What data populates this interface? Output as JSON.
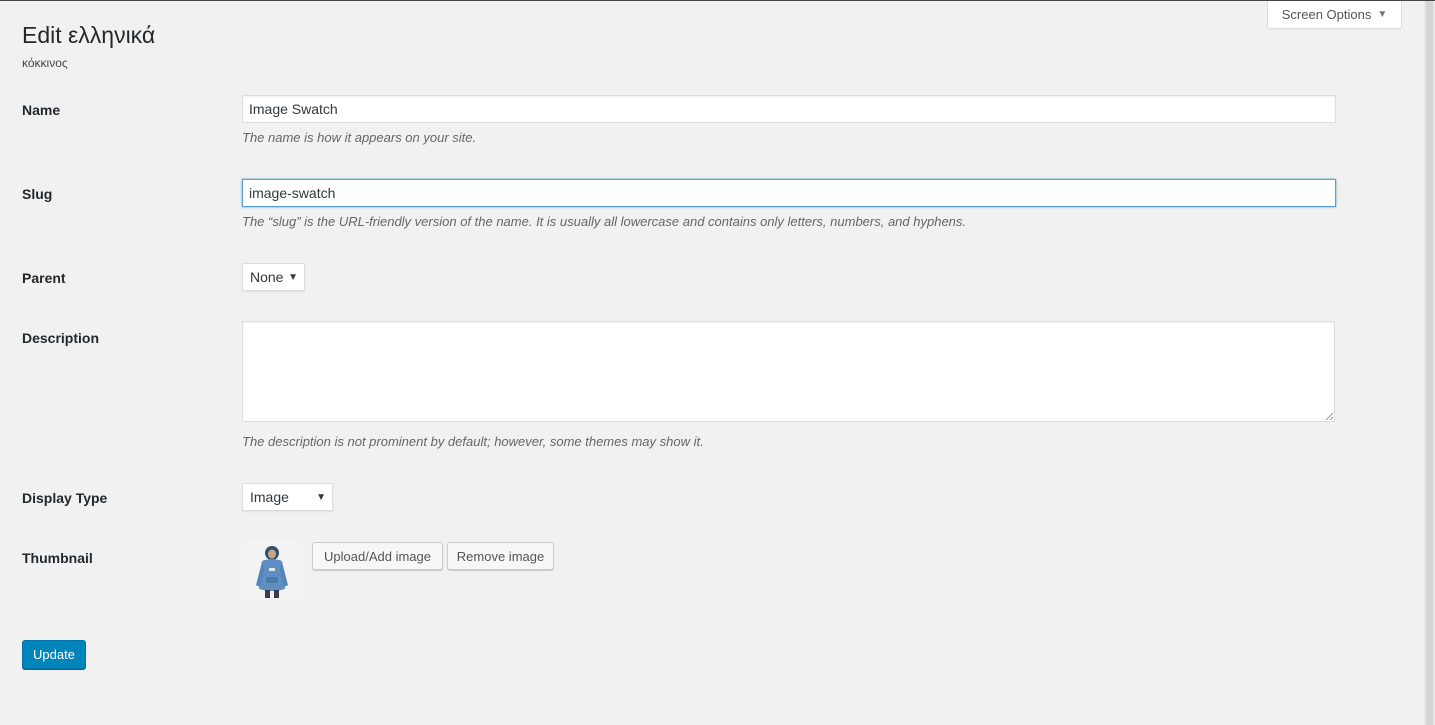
{
  "header": {
    "title": "Edit ελληνικά",
    "subtitle": "κόκκινος",
    "screen_options": "Screen Options"
  },
  "form": {
    "name": {
      "label": "Name",
      "value": "Image Swatch",
      "description": "The name is how it appears on your site."
    },
    "slug": {
      "label": "Slug",
      "value": "image-swatch",
      "description": "The “slug” is the URL-friendly version of the name. It is usually all lowercase and contains only letters, numbers, and hyphens."
    },
    "parent": {
      "label": "Parent",
      "selected": "None"
    },
    "description": {
      "label": "Description",
      "value": "",
      "description": "The description is not prominent by default; however, some themes may show it."
    },
    "display_type": {
      "label": "Display Type",
      "selected": "Image"
    },
    "thumbnail": {
      "label": "Thumbnail",
      "image_icon": "hoodie-image",
      "upload_label": "Upload/Add image",
      "remove_label": "Remove image"
    },
    "submit_label": "Update"
  },
  "colors": {
    "primary_button": "#0085ba",
    "focus_border": "#5b9dd9",
    "background": "#f1f1f1"
  }
}
